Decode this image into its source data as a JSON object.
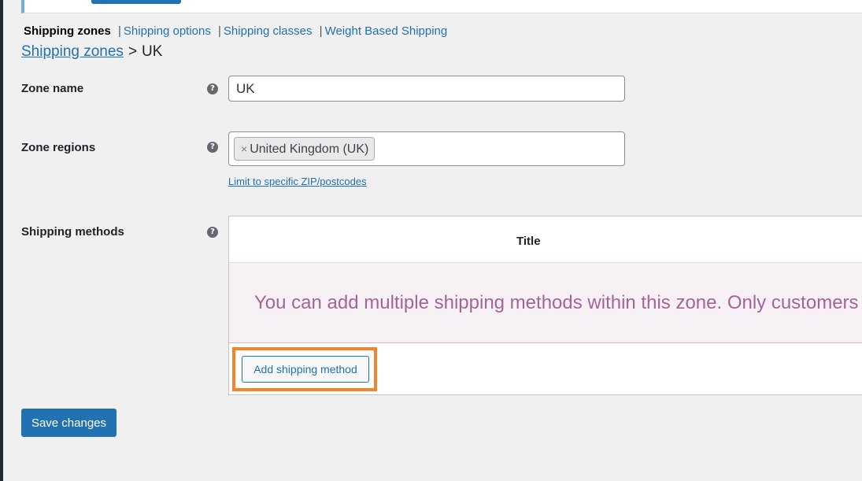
{
  "nav": {
    "current": "Shipping zones",
    "links": [
      "Shipping options",
      "Shipping classes",
      "Weight Based Shipping"
    ],
    "separator": "|"
  },
  "breadcrumb": {
    "parent": "Shipping zones",
    "separator": ">",
    "current": "UK"
  },
  "form": {
    "zone_name": {
      "label": "Zone name",
      "value": "UK"
    },
    "zone_regions": {
      "label": "Zone regions",
      "selected": [
        "United Kingdom (UK)"
      ],
      "remove_glyph": "×",
      "limit_link": "Limit to specific ZIP/postcodes"
    },
    "shipping_methods": {
      "label": "Shipping methods",
      "column_title": "Title",
      "blank_message": "You can add multiple shipping methods within this zone. Only customers w",
      "add_button": "Add shipping method"
    },
    "help_glyph": "?"
  },
  "actions": {
    "save": "Save changes"
  },
  "colors": {
    "accent": "#2271b1",
    "highlight": "#f5832a",
    "blank_bg": "#f7f0f5",
    "blank_text": "#a16696"
  }
}
